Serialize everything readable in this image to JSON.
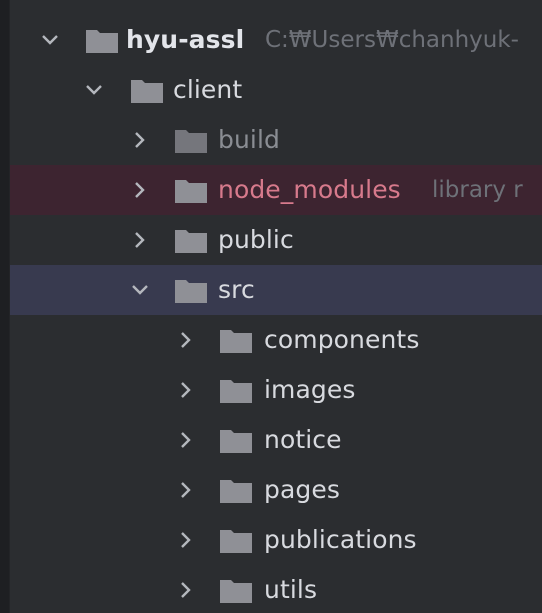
{
  "tree": {
    "root": {
      "label": "hyu-assl",
      "path_hint": "C:₩Users₩chanhyuk-"
    },
    "client": {
      "label": "client"
    },
    "build": {
      "label": "build"
    },
    "node_modules": {
      "label": "node_modules",
      "hint": "library r"
    },
    "public": {
      "label": "public"
    },
    "src": {
      "label": "src"
    },
    "components": {
      "label": "components"
    },
    "images": {
      "label": "images"
    },
    "notice": {
      "label": "notice"
    },
    "pages": {
      "label": "pages"
    },
    "publications": {
      "label": "publications"
    },
    "utils": {
      "label": "utils"
    }
  },
  "colors": {
    "panel_bg": "#2b2d30",
    "excluded_row_bg": "#3d2430",
    "selected_row_bg": "#383a4f",
    "folder": "#8f9096",
    "excluded_text": "#d77a8c",
    "dim_text": "#8a8d93"
  },
  "icons": {
    "expanded": "chevron-down-icon",
    "collapsed": "chevron-right-icon",
    "folder": "folder-icon"
  }
}
